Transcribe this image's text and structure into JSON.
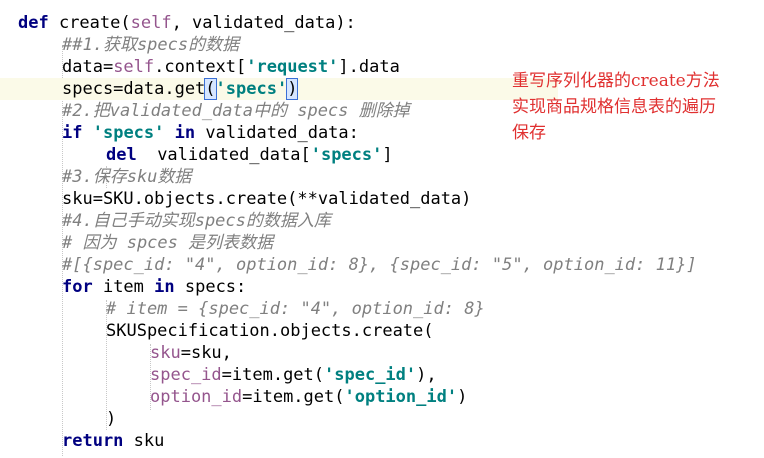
{
  "code": {
    "l1": {
      "kw": "def",
      "rest1": " create(",
      "self": "self",
      "rest2": ", validated_data):"
    },
    "l2": {
      "comment": "##1.获取specs的数据"
    },
    "l3": {
      "a": "data=",
      "self": "self",
      "b": ".context[",
      "s": "'request'",
      "c": "].data"
    },
    "l4": {
      "a": "specs=data.get",
      "paren_open": "(",
      "s": "'specs'",
      "paren_close": ")"
    },
    "l5": {
      "comment": "#2.把validated_data中的 specs 删除掉"
    },
    "l6": {
      "kw1": "if",
      "sp1": " ",
      "s": "'specs'",
      "sp2": " ",
      "kw2": "in",
      "rest": " validated_data:"
    },
    "l7": {
      "kw": "del",
      "a": "  validated_data[",
      "s": "'specs'",
      "b": "]"
    },
    "l8": {
      "comment": "#3.保存sku数据"
    },
    "l9": {
      "a": "sku=SKU.objects.create(**validated_data)"
    },
    "l10": {
      "comment": "#4.自己手动实现specs的数据入库"
    },
    "l11": {
      "comment": "# 因为 spces 是列表数据"
    },
    "l12": {
      "comment": "#[{spec_id: \"4\", option_id: 8}, {spec_id: \"5\", option_id: 11}]"
    },
    "l13": {
      "kw1": "for",
      "a": " item ",
      "kw2": "in",
      "b": " specs:"
    },
    "l14": {
      "comment": "# item = {spec_id: \"4\", option_id: 8}"
    },
    "l15": {
      "a": "SKUSpecification.objects.create("
    },
    "l16": {
      "p": "sku",
      "b": "=sku,"
    },
    "l17": {
      "p": "spec_id",
      "a": "=item.get(",
      "s": "'spec_id'",
      "b": "),"
    },
    "l18": {
      "p": "option_id",
      "a": "=item.get(",
      "s": "'option_id'",
      "b": ")"
    },
    "l19": {
      "a": ")"
    },
    "l20": {
      "kw": "return",
      "a": " sku"
    }
  },
  "annotation": {
    "line1": "重写序列化器的create方法",
    "line2": "实现商品规格信息表的遍历",
    "line3": "保存"
  },
  "colors": {
    "keyword": "#000080",
    "self": "#94558d",
    "string": "#008080",
    "comment": "#808080",
    "annotation": "#e03030",
    "current_line": "#fbfae8"
  }
}
